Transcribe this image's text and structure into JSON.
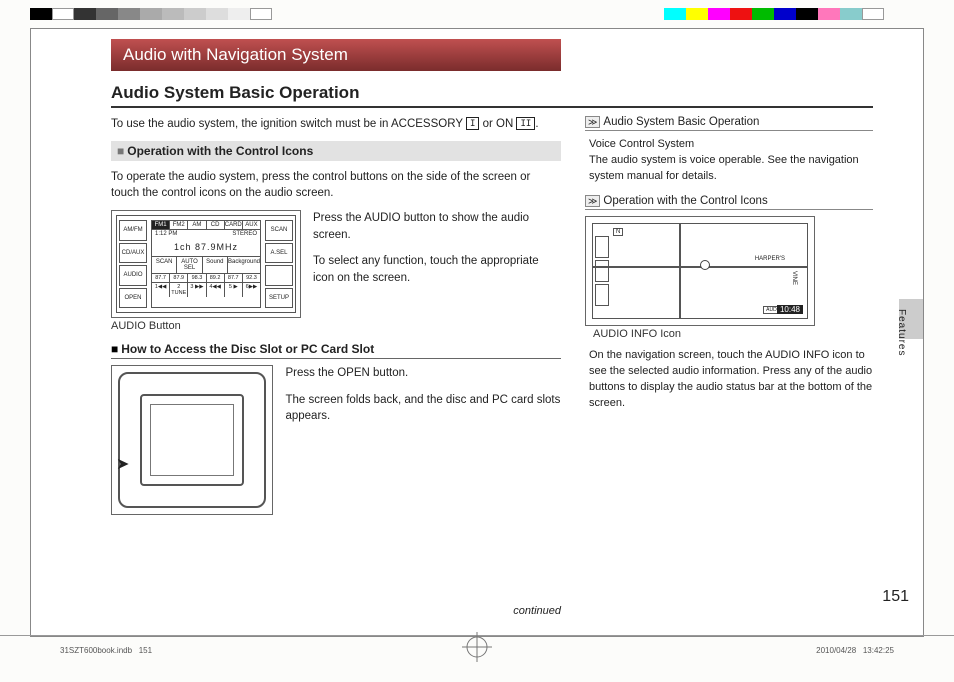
{
  "colorbar_left": [
    "#000",
    "#fff",
    "#444",
    "#fff",
    "#777",
    "#fff",
    "#999",
    "#fff",
    "#bbb",
    "#fff",
    "#ddd"
  ],
  "colorbar_right": [
    "#0ff",
    "#ff0",
    "#f0f",
    "#e11",
    "#0b0",
    "#00c",
    "#000",
    "#f5a",
    "#8a2",
    "#fff"
  ],
  "header": "Audio with Navigation System",
  "section_title": "Audio System Basic Operation",
  "intro_prefix": "To use the audio system, the ignition switch must be in ACCESSORY ",
  "key1": "I",
  "intro_mid": " or ON ",
  "key2": "II",
  "intro_suffix": ".",
  "sub_icons_title": "Operation with the Control Icons",
  "icons_para": "To operate the audio system, press the control buttons on the side of the screen or touch the control icons on the audio screen.",
  "fig1_text1": "Press the AUDIO button to show the audio screen.",
  "fig1_text2": "To select any function, touch the appropriate icon on the screen.",
  "fig1_caption": "AUDIO Button",
  "audio_btns_left": [
    "AM/FM",
    "CD/AUX",
    "AUDIO",
    "OPEN"
  ],
  "audio_btns_right": [
    "SCAN",
    "A.SEL",
    "",
    "SETUP"
  ],
  "audio_tabs": [
    "FM1",
    "FM2",
    "AM",
    "CD",
    "CARD",
    "AUX"
  ],
  "audio_time": "1:12 PM",
  "audio_stereo": "STEREO",
  "audio_freq": "1ch  87.9MHz",
  "audio_row2": [
    "SCAN",
    "AUTO SEL",
    "Sound",
    "Background"
  ],
  "audio_presets": [
    "87.7",
    "87.9",
    "98.3",
    "89.2",
    "87.7",
    "92.3"
  ],
  "audio_presets2": [
    "1◀◀",
    "2 TUNE",
    "3 ▶▶",
    "4◀◀",
    "5 ▶",
    "6▶▶"
  ],
  "sub_disc_title": "How to Access the Disc Slot or PC Card Slot",
  "fig2_text1": "Press the OPEN button.",
  "fig2_text2": "The screen folds back, and the disc and PC card slots appears.",
  "continued": "continued",
  "side_ref1": "Audio System Basic Operation",
  "side_block1a": "Voice Control System",
  "side_block1b": "The audio system is voice operable. See the navigation system manual for details.",
  "side_ref2": "Operation with the Control Icons",
  "side_fig_caption": "AUDIO INFO Icon",
  "map_label1": "HARPER'S",
  "map_label2": "VINE",
  "map_time": "10:48",
  "map_north": "N",
  "side_block2": "On the navigation screen, touch the AUDIO INFO icon to see the selected audio information. Press any of the audio buttons to display the audio status bar at the bottom of the screen.",
  "vert_label": "Features",
  "page_number": "151",
  "footer_file": "31SZT600book.indb",
  "footer_page": "151",
  "footer_date": "2010/04/28",
  "footer_time": "13:42:25"
}
